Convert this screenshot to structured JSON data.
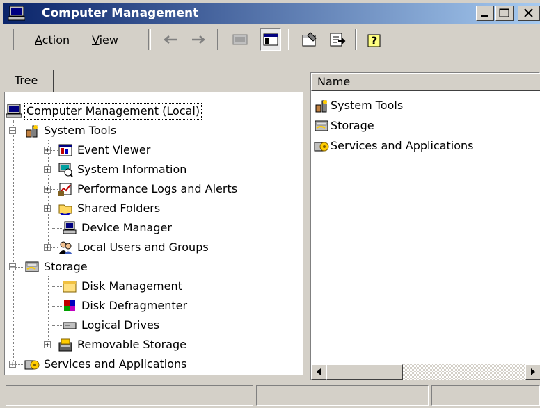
{
  "window": {
    "title": "Computer Management"
  },
  "menu": {
    "action": "Action",
    "action_mnemonic": "A",
    "action_rest": "ction",
    "view": "View",
    "view_mnemonic": "V",
    "view_rest": "iew"
  },
  "tabs": {
    "tree": "Tree"
  },
  "tree": {
    "root": "Computer Management (Local)",
    "system_tools": "System Tools",
    "event_viewer": "Event Viewer",
    "system_information": "System Information",
    "performance_logs": "Performance Logs and Alerts",
    "shared_folders": "Shared Folders",
    "device_manager": "Device Manager",
    "local_users": "Local Users and Groups",
    "storage": "Storage",
    "disk_management": "Disk Management",
    "disk_defragmenter": "Disk Defragmenter",
    "logical_drives": "Logical Drives",
    "removable_storage": "Removable Storage",
    "services_apps": "Services and Applications"
  },
  "list": {
    "column_name": "Name",
    "items": [
      "System Tools",
      "Storage",
      "Services and Applications"
    ]
  },
  "colors": {
    "title_start": "#0a246a",
    "title_end": "#a6caf0",
    "selection": "#0a246a"
  }
}
